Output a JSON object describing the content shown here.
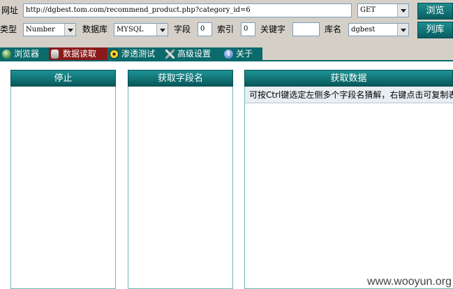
{
  "row1": {
    "url_label": "网址",
    "url_value": "http://dgbest.tom.com/recommend_product.php?category_id=6",
    "method": "GET",
    "browse_button": "浏览"
  },
  "row2": {
    "type_label": "类型",
    "type_value": "Number",
    "db_label": "数据库",
    "db_value": "MYSQL",
    "field_label": "字段",
    "field_value": "0",
    "index_label": "索引",
    "index_value": "0",
    "keyword_label": "关键字",
    "keyword_value": "",
    "dbname_label": "库名",
    "dbname_value": "dgbest",
    "list_button": "列库"
  },
  "tabs": [
    {
      "label": "浏览器",
      "icon": "globe-icon",
      "active": false
    },
    {
      "label": "数据读取",
      "icon": "database-icon",
      "active": true
    },
    {
      "label": "渗透测试",
      "icon": "radiation-icon",
      "active": false
    },
    {
      "label": "高级设置",
      "icon": "tools-icon",
      "active": false
    },
    {
      "label": "关于",
      "icon": "info-icon",
      "active": false
    }
  ],
  "panels": {
    "stop_button": "停止",
    "get_fields_button": "获取字段名",
    "get_data_button": "获取数据",
    "hint": "可按Ctrl键选定左侧多个字段名猜解，右键点击可复制表格"
  },
  "watermark": "www.wooyun.org",
  "colors": {
    "accent": "#0b6a6c",
    "active_tab": "#8b1a1a",
    "background": "#d4d0c8"
  }
}
